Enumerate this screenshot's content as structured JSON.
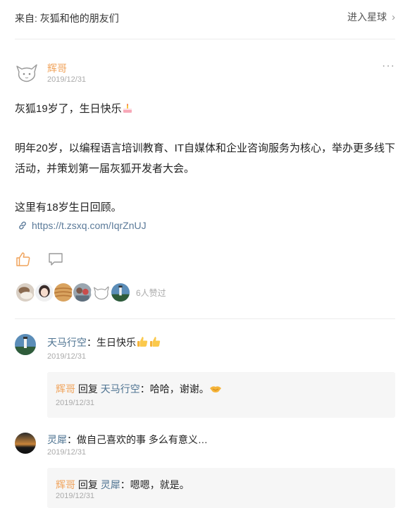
{
  "header": {
    "source_prefix": "来自:",
    "source_name": "灰狐和他的朋友们",
    "enter_label": "进入星球",
    "chevron_glyph": "›"
  },
  "post": {
    "author": "辉哥",
    "date": "2019/12/31",
    "more_glyph": "···",
    "line1": "灰狐19岁了，生日快乐",
    "para2": "明年20岁，以编程语言培训教育、IT自媒体和企业咨询服务为核心，举办更多线下活动，并策划第一届灰狐开发者大会。",
    "para3": "这里有18岁生日回顾。",
    "link": "https://t.zsxq.com/IqrZnUJ",
    "likes_text": "6人赞过"
  },
  "comments": [
    {
      "user": "天马行空",
      "sep": "：",
      "text": "生日快乐",
      "date": "2019/12/31",
      "reply": {
        "author": "辉哥",
        "verb": "回复",
        "target": "天马行空",
        "sep": "：",
        "text": "哈哈，谢谢。",
        "date": "2019/12/31"
      }
    },
    {
      "user": "灵犀",
      "sep": "：",
      "text": "做自己喜欢的事 多么有意义…",
      "date": "2019/12/31",
      "reply": {
        "author": "辉哥",
        "verb": "回复",
        "target": "灵犀",
        "sep": "：",
        "text": "嗯嗯，就是。",
        "date": "2019/12/31"
      }
    }
  ],
  "colors": {
    "author_orange": "#f0a35b",
    "user_blue": "#4e7391",
    "link_blue": "#5b7a99",
    "muted": "#aaaaaa"
  },
  "icons": [
    "fox-avatar-icon",
    "link-icon",
    "like-icon",
    "comment-icon",
    "cake-emoji-icon",
    "thumbs-up-emoji-icon",
    "handshake-emoji-icon"
  ]
}
